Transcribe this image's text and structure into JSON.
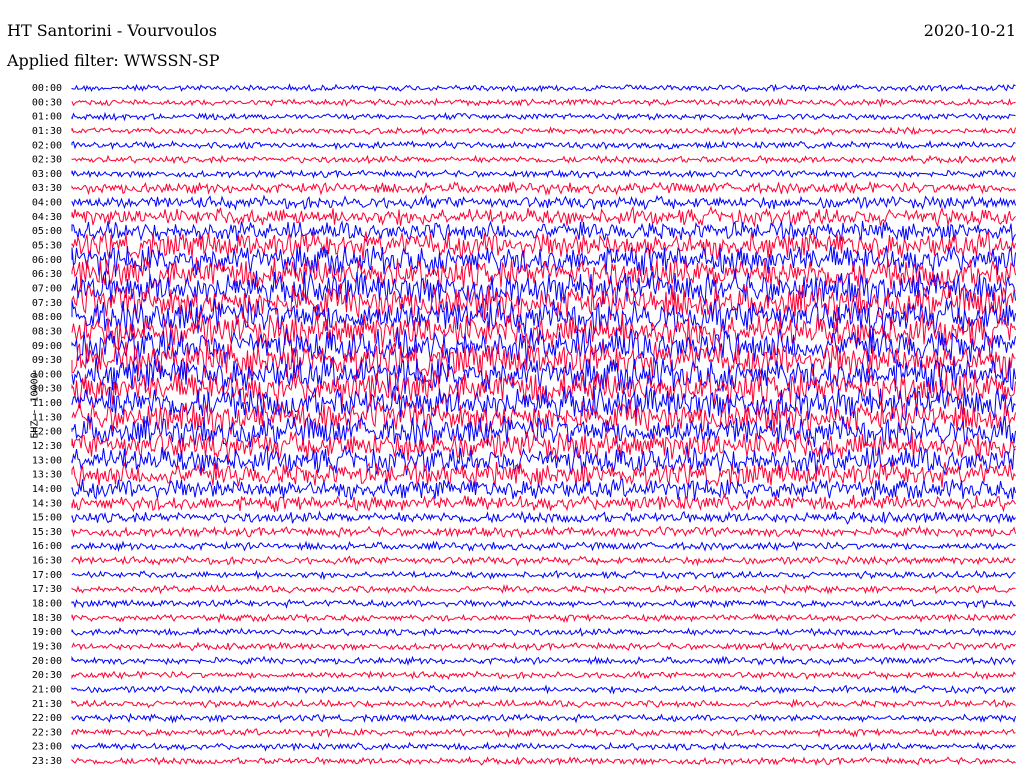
{
  "header": {
    "station": "HT Santorini - Vourvoulos",
    "date": "2020-10-21",
    "filter": "Applied filter: WWSSN-SP"
  },
  "colors": {
    "even": "#0000ff",
    "odd": "#ff0033"
  },
  "chart_data": {
    "type": "line",
    "title": "HT Santorini - Vourvoulos",
    "ylabel": "EHZ - 10000",
    "rows": [
      "00:00",
      "00:30",
      "01:00",
      "01:30",
      "02:00",
      "02:30",
      "03:00",
      "03:30",
      "04:00",
      "04:30",
      "05:00",
      "05:30",
      "06:00",
      "06:30",
      "07:00",
      "07:30",
      "08:00",
      "08:30",
      "09:00",
      "09:30",
      "10:00",
      "10:30",
      "11:00",
      "11:30",
      "12:00",
      "12:30",
      "13:00",
      "13:30",
      "14:00",
      "14:30",
      "15:00",
      "15:30",
      "16:00",
      "16:30",
      "17:00",
      "17:30",
      "18:00",
      "18:30",
      "19:00",
      "19:30",
      "20:00",
      "20:30",
      "21:00",
      "21:30",
      "22:00",
      "22:30",
      "23:00",
      "23:30"
    ],
    "noise_level": [
      0.1,
      0.1,
      0.1,
      0.1,
      0.12,
      0.12,
      0.12,
      0.25,
      0.3,
      0.45,
      0.5,
      0.75,
      0.85,
      0.9,
      0.95,
      1.0,
      1.0,
      1.0,
      1.0,
      1.0,
      1.0,
      1.0,
      0.95,
      0.9,
      0.85,
      0.8,
      0.75,
      0.65,
      0.55,
      0.4,
      0.25,
      0.2,
      0.15,
      0.15,
      0.12,
      0.12,
      0.12,
      0.12,
      0.12,
      0.12,
      0.12,
      0.12,
      0.12,
      0.12,
      0.12,
      0.12,
      0.12,
      0.12
    ]
  }
}
